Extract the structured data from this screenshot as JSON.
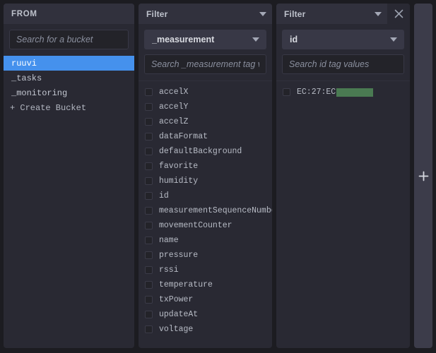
{
  "from_panel": {
    "header_title": "FROM",
    "search_placeholder": "Search for a bucket",
    "search_value": "",
    "buckets": [
      {
        "label": "ruuvi",
        "selected": true
      },
      {
        "label": "_tasks",
        "selected": false
      },
      {
        "label": "_monitoring",
        "selected": false
      }
    ],
    "create_bucket_label": "+ Create Bucket"
  },
  "filter_measurement": {
    "header_title": "Filter",
    "tag_key": "_measurement",
    "search_placeholder": "Search _measurement tag values",
    "search_value": "",
    "values": [
      {
        "label": "accelX",
        "checked": false
      },
      {
        "label": "accelY",
        "checked": false
      },
      {
        "label": "accelZ",
        "checked": false
      },
      {
        "label": "dataFormat",
        "checked": false
      },
      {
        "label": "defaultBackground",
        "checked": false
      },
      {
        "label": "favorite",
        "checked": false
      },
      {
        "label": "humidity",
        "checked": false
      },
      {
        "label": "id",
        "checked": false
      },
      {
        "label": "measurementSequenceNumber",
        "checked": false
      },
      {
        "label": "movementCounter",
        "checked": false
      },
      {
        "label": "name",
        "checked": false
      },
      {
        "label": "pressure",
        "checked": false
      },
      {
        "label": "rssi",
        "checked": false
      },
      {
        "label": "temperature",
        "checked": false
      },
      {
        "label": "txPower",
        "checked": false
      },
      {
        "label": "updateAt",
        "checked": false
      },
      {
        "label": "voltage",
        "checked": false
      }
    ]
  },
  "filter_id": {
    "header_title": "Filter",
    "tag_key": "id",
    "search_placeholder": "Search id tag values",
    "search_value": "",
    "values": [
      {
        "label": "EC:27:EC",
        "checked": false,
        "redacted": true
      }
    ]
  },
  "add_card": {
    "label": "+"
  },
  "colors": {
    "canvas_background": "#1c1c21",
    "panel_background": "#292933",
    "panel_header_background": "#31313d",
    "selection_blue": "#4591ed",
    "input_background": "#232329",
    "dropdown_background": "#383846",
    "redaction_green": "#4a7a52",
    "text_primary": "#c6cad3",
    "text_muted": "#8a8f9e"
  }
}
